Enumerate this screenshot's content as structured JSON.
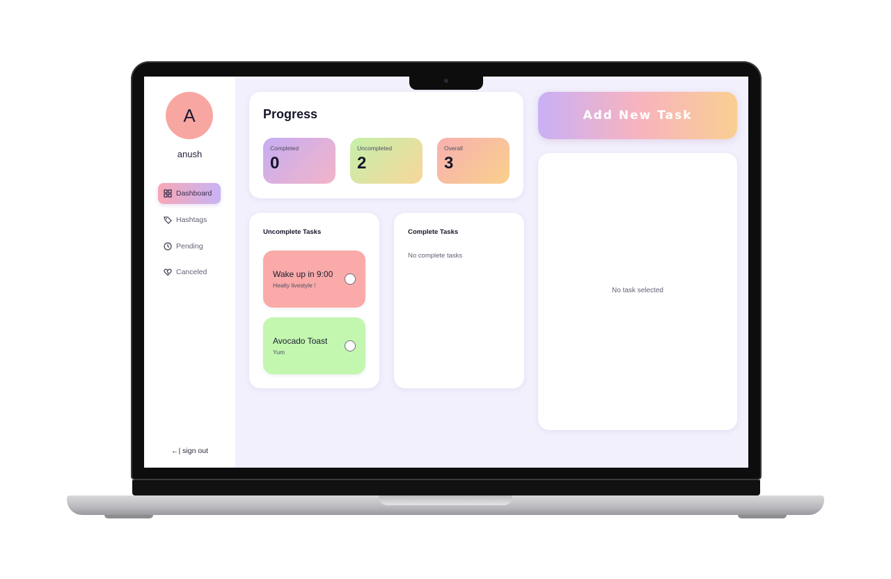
{
  "user": {
    "avatar_letter": "A",
    "name": "anush"
  },
  "sidebar": {
    "items": [
      {
        "label": "Dashboard",
        "icon": "dashboard-icon",
        "active": true
      },
      {
        "label": "Hashtags",
        "icon": "tag-icon",
        "active": false
      },
      {
        "label": "Pending",
        "icon": "clock-icon",
        "active": false
      },
      {
        "label": "Canceled",
        "icon": "broken-heart-icon",
        "active": false
      }
    ],
    "sign_out": "←| sign out"
  },
  "progress": {
    "title": "Progress",
    "stats": [
      {
        "label": "Completed",
        "value": "0"
      },
      {
        "label": "Uncompleted",
        "value": "2"
      },
      {
        "label": "Overall",
        "value": "3"
      }
    ]
  },
  "uncomplete_tasks": {
    "heading": "Uncomplete Tasks",
    "items": [
      {
        "title": "Wake up in 9:00",
        "subtitle": "Healty livestyle !",
        "color": "#f9aaa9"
      },
      {
        "title": "Avocado Toast",
        "subtitle": "Yum",
        "color": "#c3f7b0"
      }
    ]
  },
  "complete_tasks": {
    "heading": "Complete Tasks",
    "empty_text": "No complete tasks"
  },
  "add_task": {
    "label": "Add New Task"
  },
  "detail": {
    "empty_text": "No task selected"
  },
  "colors": {
    "background": "#f1f0fc",
    "avatar": "#f8a6a2",
    "accent_gradient": [
      "#c9b0f6",
      "#f7b3bf",
      "#f9cf92"
    ]
  }
}
